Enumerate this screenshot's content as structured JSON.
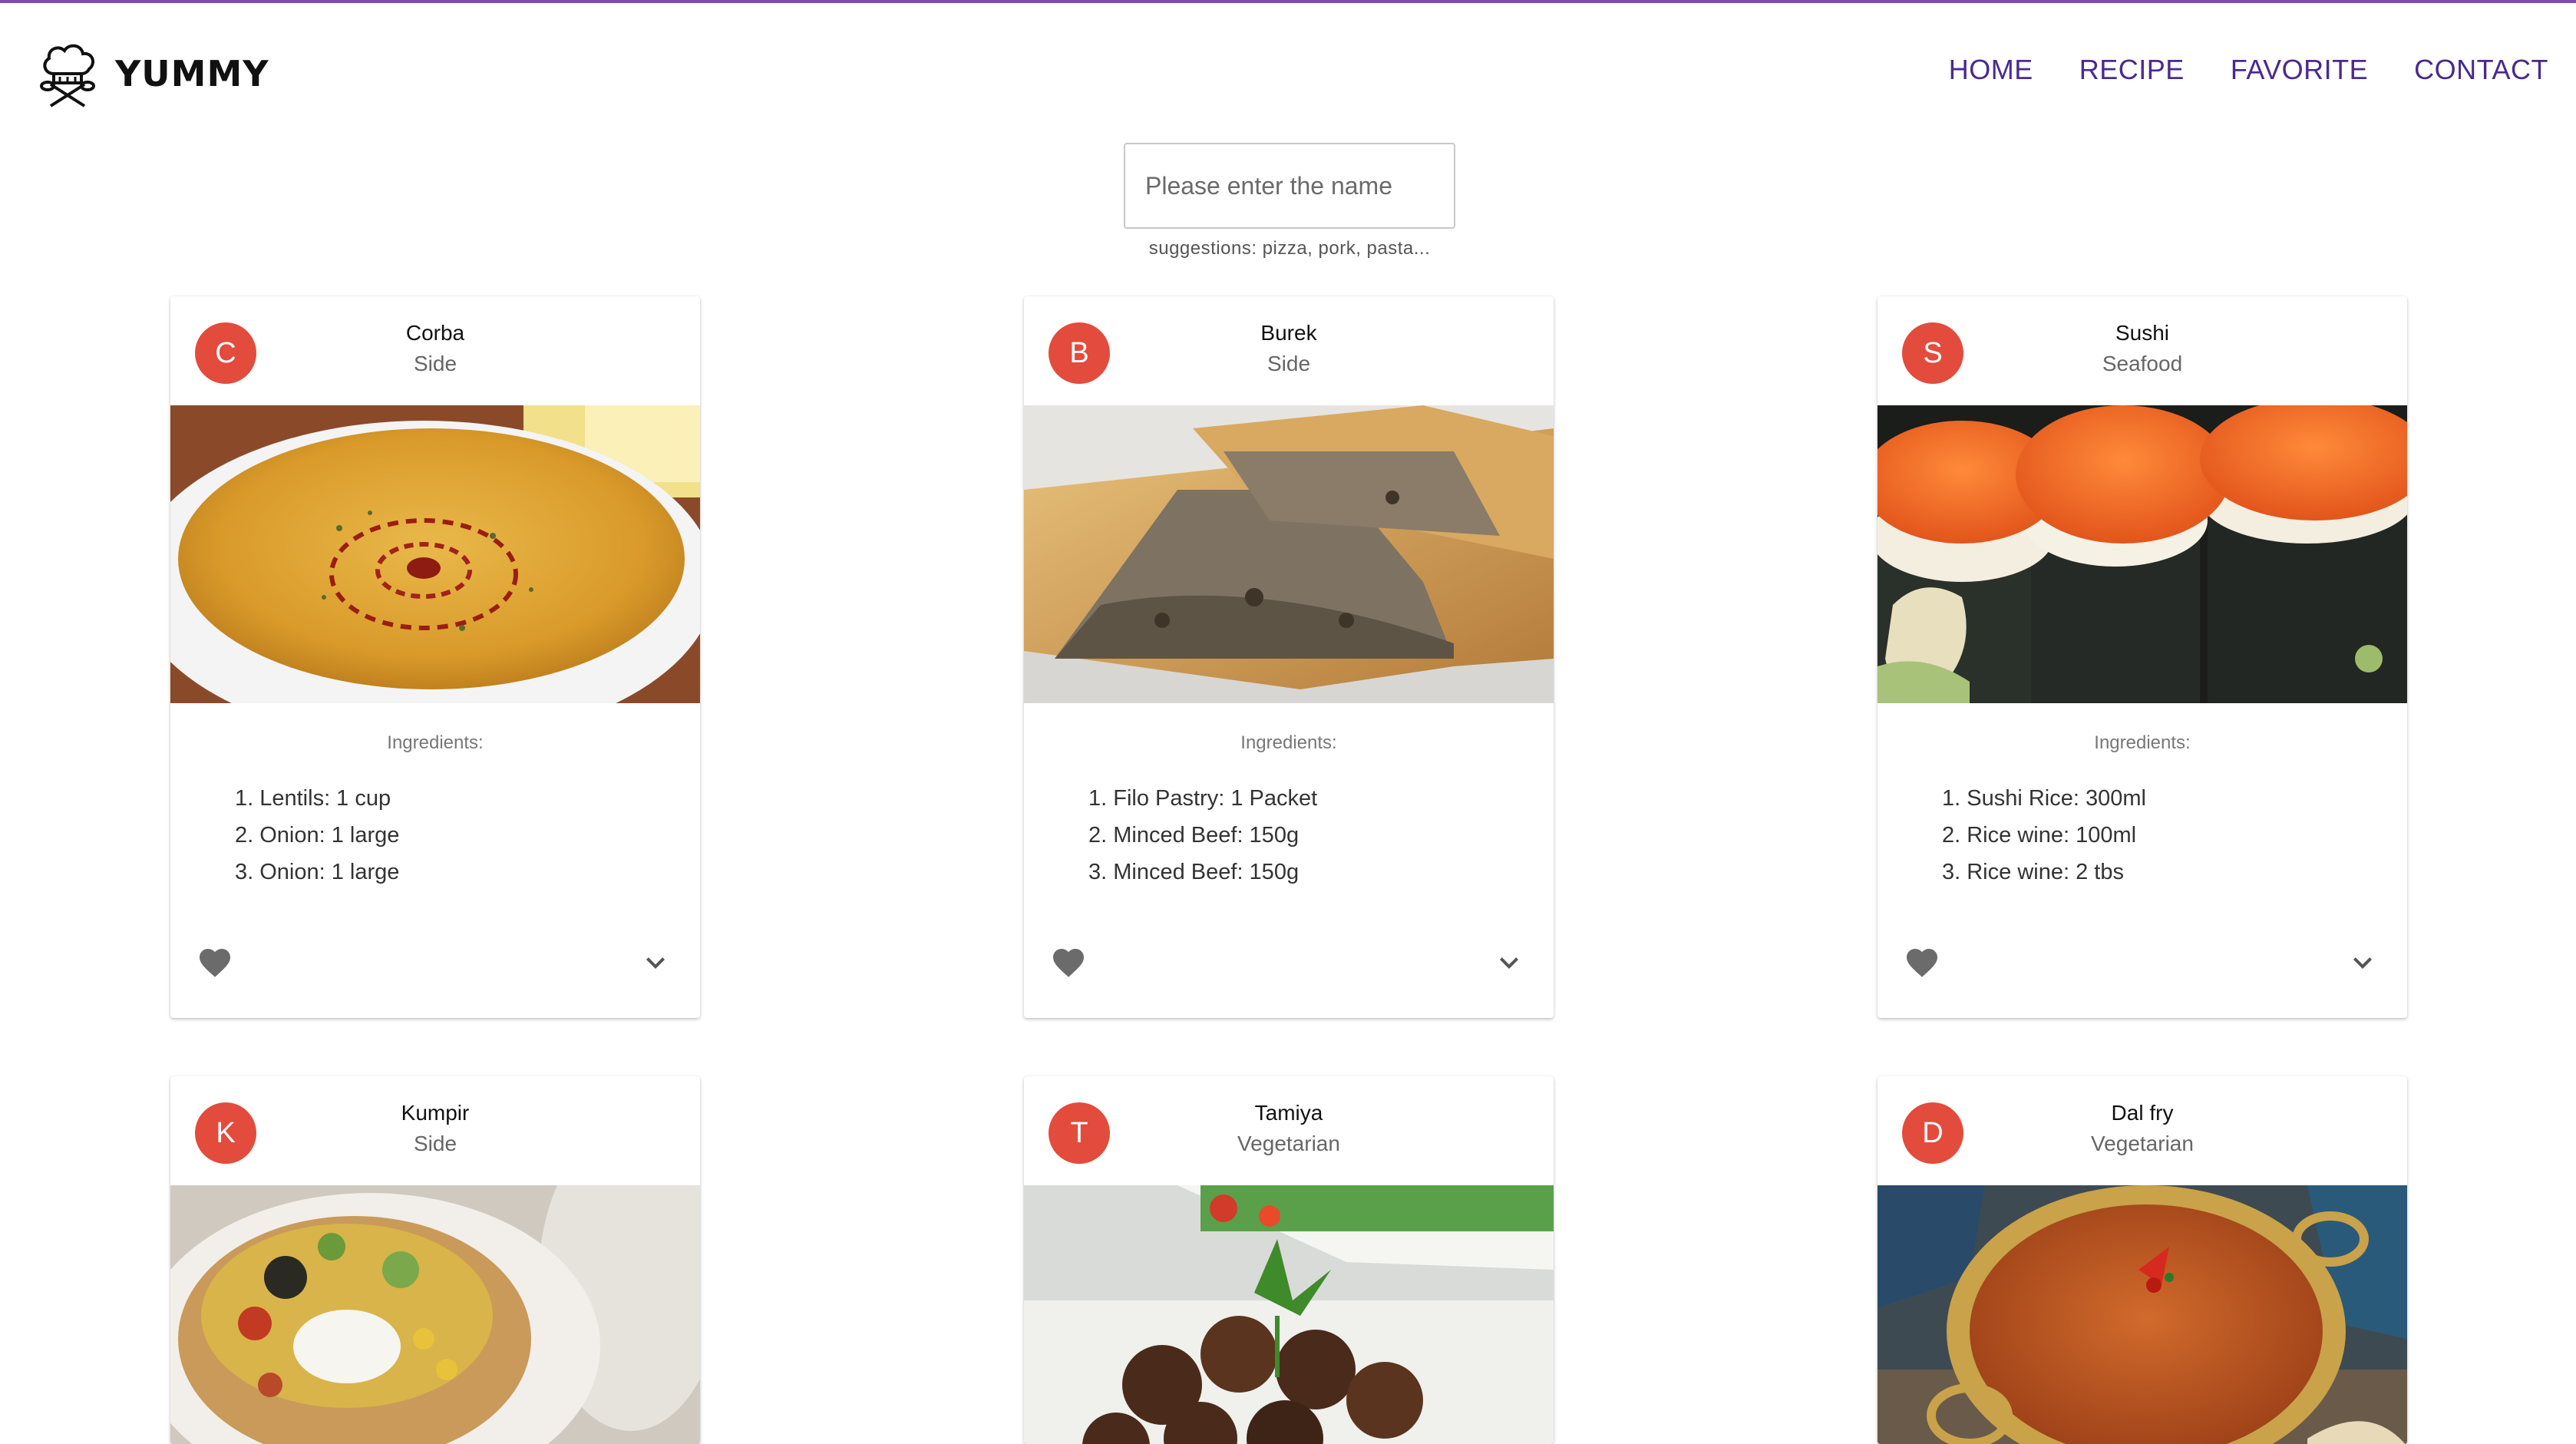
{
  "brand": {
    "name": "YUMMY",
    "icon": "chef-hat-utensils-icon"
  },
  "nav": {
    "home": "HOME",
    "recipe": "RECIPE",
    "favorite": "FAVORITE",
    "contact": "CONTACT"
  },
  "search": {
    "placeholder": "Please enter the name",
    "value": "",
    "hint": "suggestions: pizza, pork, pasta..."
  },
  "colors": {
    "accent": "#4a2a8f",
    "avatar": "#e34b3c"
  },
  "cards": [
    {
      "initial": "C",
      "name": "Corba",
      "category": "Side",
      "ingredients_label": "Ingredients:",
      "ingredients": [
        "1. Lentils: 1 cup",
        "2. Onion: 1 large",
        "3. Onion: 1 large"
      ],
      "image": "soup-bowl-photo"
    },
    {
      "initial": "B",
      "name": "Burek",
      "category": "Side",
      "ingredients_label": "Ingredients:",
      "ingredients": [
        "1. Filo Pastry: 1 Packet",
        "2. Minced Beef: 150g",
        "3. Minced Beef: 150g"
      ],
      "image": "burek-pastry-photo"
    },
    {
      "initial": "S",
      "name": "Sushi",
      "category": "Seafood",
      "ingredients_label": "Ingredients:",
      "ingredients": [
        "1. Sushi Rice: 300ml",
        "2. Rice wine: 100ml",
        "3. Rice wine: 2 tbs"
      ],
      "image": "sushi-rolls-photo"
    },
    {
      "initial": "K",
      "name": "Kumpir",
      "category": "Side",
      "image": "stuffed-potato-photo"
    },
    {
      "initial": "T",
      "name": "Tamiya",
      "category": "Vegetarian",
      "image": "falafel-plate-photo"
    },
    {
      "initial": "D",
      "name": "Dal fry",
      "category": "Vegetarian",
      "image": "dal-curry-photo"
    }
  ]
}
